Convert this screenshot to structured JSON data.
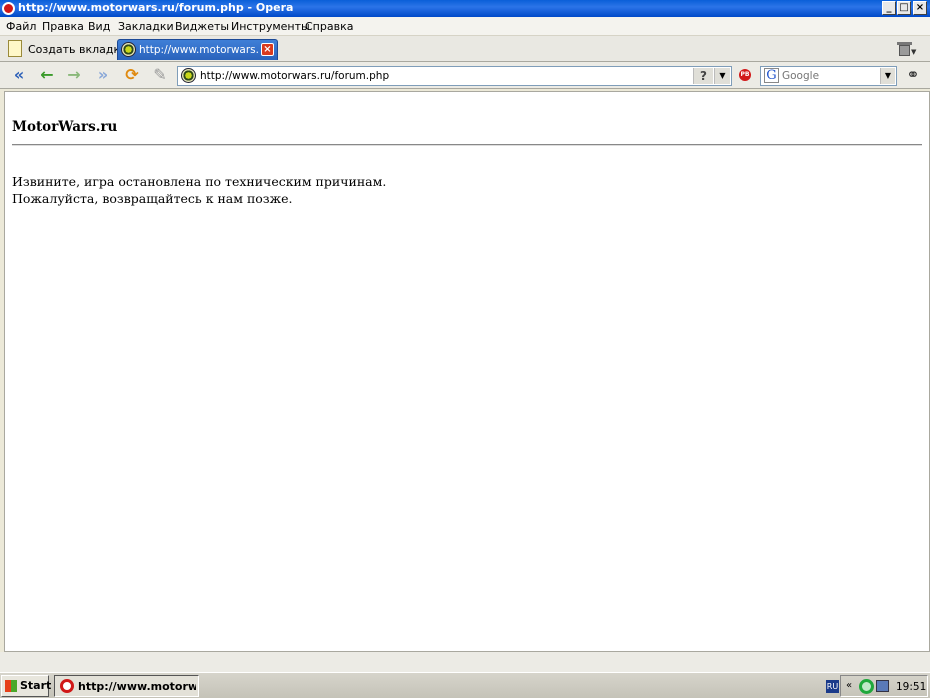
{
  "window": {
    "title": "http://www.motorwars.ru/forum.php - Opera",
    "min_label": "_",
    "max_label": "□",
    "close_label": "×"
  },
  "menu": {
    "items": [
      "Файл",
      "Правка",
      "Вид",
      "Закладки",
      "Виджеты",
      "Инструменты",
      "Справка"
    ]
  },
  "tabs": {
    "new_tab_label": "Создать вкладку",
    "active_tab_label": "http://www.motorwars.r...",
    "close_label": "×"
  },
  "toolbar": {
    "back_glyph": "«",
    "prev_glyph": "←",
    "next_glyph": "→",
    "forward_glyph": "»",
    "reload_glyph": "⟳",
    "edit_glyph": "✎"
  },
  "address": {
    "url": "http://www.motorwars.ru/forum.php",
    "help_label": "?",
    "dropdown_glyph": "▼"
  },
  "search": {
    "engine_glyph": "G",
    "placeholder": "Google",
    "dropdown_glyph": "▼"
  },
  "page": {
    "title": "MotorWars.ru",
    "message_line1": "Извините, игра остановлена по техническим причинам.",
    "message_line2": "Пожалуйста, возвращайтесь к нам позже."
  },
  "taskbar": {
    "start_label": "Start",
    "task_label": "http://www.motorwa...",
    "lang": "RU",
    "tray_chevron": "«",
    "clock": "19:51"
  },
  "colors": {
    "titlebar": "#0a5fd8",
    "active_tab": "#3f7fd7",
    "tab_close": "#d93a1e",
    "opera_red": "#d01818"
  },
  "icons": [
    "opera-icon",
    "new-tab-icon",
    "globe-icon",
    "trash-icon",
    "back-icon",
    "previous-icon",
    "next-icon",
    "forward-icon",
    "reload-icon",
    "edit-icon",
    "content-block-icon",
    "google-icon",
    "glasses-icon",
    "windows-flag-icon",
    "network-icon",
    "computer-icon"
  ]
}
